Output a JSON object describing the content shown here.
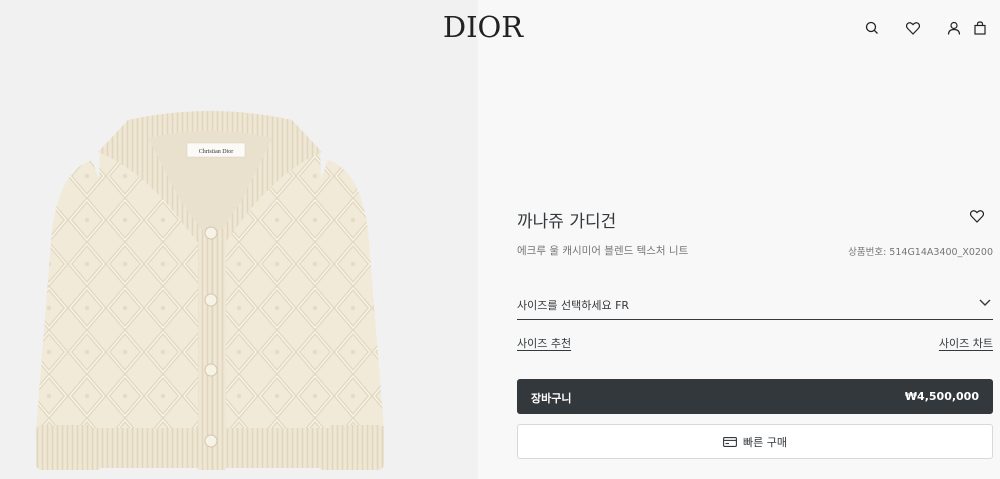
{
  "header": {
    "logo": "DIOR",
    "icons": [
      "search-icon",
      "heart-icon",
      "account-icon",
      "bag-icon"
    ]
  },
  "product": {
    "title": "까나쥬 가디건",
    "subtitle": "에크루 울 캐시미어 블렌드 텍스처 니트",
    "reference": "상품번호: 514G14A3400_X0200",
    "label_text": "Christian Dior"
  },
  "size": {
    "select_label": "사이즈를 선택하세요 FR",
    "recommend_link": "사이즈 추천",
    "chart_link": "사이즈 차트"
  },
  "cart": {
    "label": "장바구니",
    "price": "₩4,500,000"
  },
  "quick_buy": {
    "label": "빠른 구매"
  },
  "colors": {
    "dark": "#33383c",
    "left_bg": "#f1f1f1",
    "right_bg": "#f8f8f8",
    "knit": "#f1ead8"
  }
}
